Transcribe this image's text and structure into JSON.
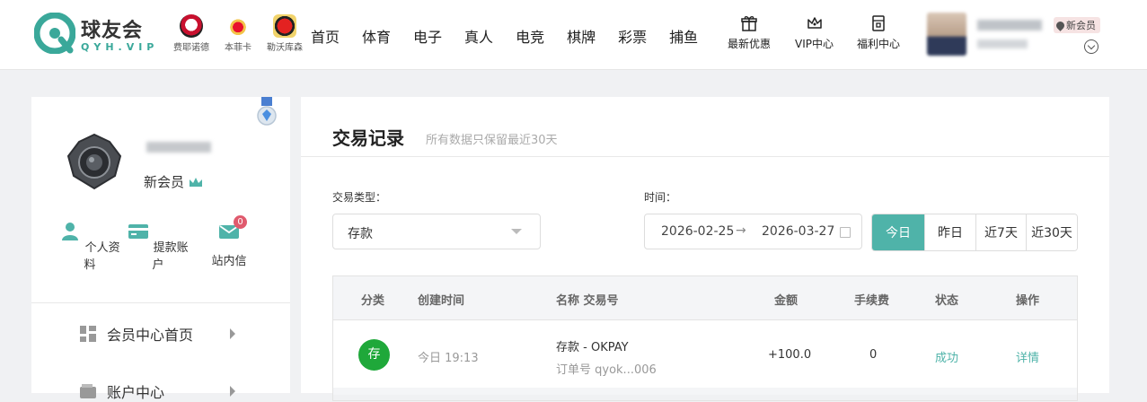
{
  "header": {
    "logo_title": "球友会",
    "logo_sub": "QYH.VIP",
    "clubs": [
      {
        "name": "费耶诺德",
        "color": "#c8102e"
      },
      {
        "name": "本菲卡",
        "color": "#e8112d"
      },
      {
        "name": "勒沃库森",
        "color": "#e32221"
      }
    ],
    "nav": [
      "首页",
      "体育",
      "电子",
      "真人",
      "电竞",
      "棋牌",
      "彩票",
      "捕鱼"
    ],
    "icon_nav": [
      {
        "label": "最新优惠",
        "icon": "gift-icon"
      },
      {
        "label": "VIP中心",
        "icon": "crown-icon"
      },
      {
        "label": "福利中心",
        "icon": "gift-card-icon"
      }
    ],
    "member_badge": "新会员"
  },
  "sidebar": {
    "level": "新会员",
    "quick_links": [
      {
        "label": "个人资料",
        "icon": "user-icon"
      },
      {
        "label": "提款账户",
        "icon": "card-icon"
      },
      {
        "label": "站内信",
        "icon": "mail-icon",
        "badge": "0"
      }
    ],
    "menu": [
      {
        "label": "会员中心首页",
        "icon": "dashboard-icon"
      },
      {
        "label": "账户中心",
        "icon": "wallet-icon"
      }
    ]
  },
  "main": {
    "title": "交易记录",
    "note": "所有数据只保留最近30天",
    "filters": {
      "type_label": "交易类型：",
      "type_value": "存款",
      "time_label": "时间：",
      "date_from": "2026-02-25",
      "date_sep": "→",
      "date_to": "2026-03-27",
      "ranges": [
        "今日",
        "昨日",
        "近7天",
        "近30天"
      ],
      "active_range": "今日"
    },
    "table": {
      "headers": [
        "分类",
        "创建时间",
        "名称 交易号",
        "金额",
        "手续费",
        "状态",
        "操作"
      ],
      "rows": [
        {
          "category": "存",
          "time": "今日 19:13",
          "name": "存款 - OKPAY",
          "order": "订单号 qyok...006",
          "amount": "+100.0",
          "fee": "0",
          "status": "成功",
          "action": "详情"
        }
      ]
    }
  },
  "colors": {
    "accent": "#4fb3a9",
    "deposit_green": "#1fa83a",
    "badge_red": "#e05a6d"
  }
}
